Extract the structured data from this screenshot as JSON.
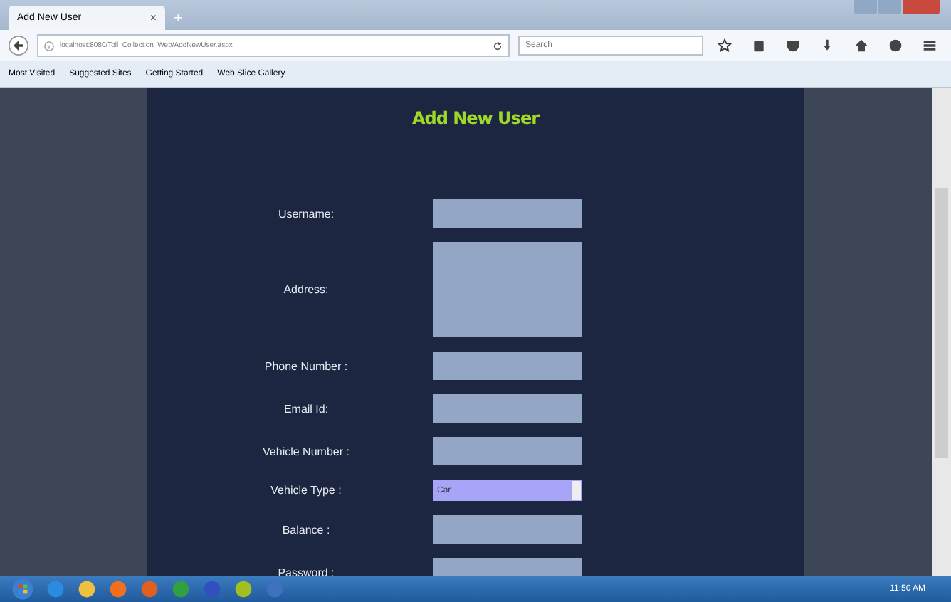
{
  "browser": {
    "tab": {
      "title": "Add New User",
      "close": "×"
    },
    "new_tab": "+",
    "url": "localhost:8080/Toll_Collection_Web/AddNewUser.aspx",
    "search": {
      "placeholder": "Search"
    },
    "bookmarks": [
      {
        "label": "Most Visited"
      },
      {
        "label": "Suggested Sites"
      },
      {
        "label": "Getting Started"
      },
      {
        "label": "Web Slice Gallery"
      }
    ]
  },
  "page": {
    "title": "Add New User",
    "fields": [
      {
        "label": "Username:",
        "kind": "text"
      },
      {
        "label": "Address:",
        "kind": "textarea"
      },
      {
        "label": "Phone Number :",
        "kind": "text"
      },
      {
        "label": "Email Id:",
        "kind": "text"
      },
      {
        "label": "Vehicle Number :",
        "kind": "text"
      },
      {
        "label": "Vehicle Type :",
        "kind": "select",
        "value": "Car"
      },
      {
        "label": "Balance :",
        "kind": "text"
      },
      {
        "label": "Password :",
        "kind": "text"
      }
    ]
  },
  "taskbar": {
    "time": "11:50 AM"
  }
}
